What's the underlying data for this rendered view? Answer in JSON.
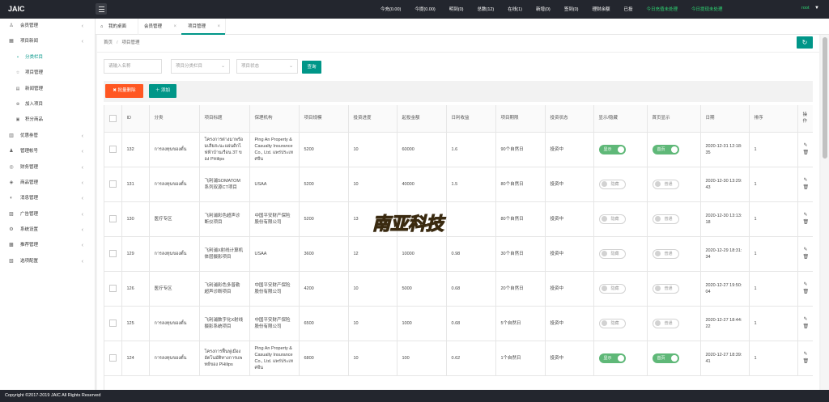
{
  "app": {
    "logo": "JAIC",
    "footer": "Copyright ©2017-2019 JAIC All Rights Reserved"
  },
  "header": {
    "stats": [
      {
        "label": "今充(0.00)",
        "color": "#ffffff"
      },
      {
        "label": "今提(0.00)",
        "color": "#ffffff"
      },
      {
        "label": "明到(0)",
        "color": "#ffffff"
      },
      {
        "label": "总数(12)",
        "color": "#ffffff"
      },
      {
        "label": "在线(1)",
        "color": "#ffffff"
      },
      {
        "label": "新增(0)",
        "color": "#ffffff"
      },
      {
        "label": "签到(0)",
        "color": "#ffffff"
      },
      {
        "label": "理财余额",
        "color": "#ffffff"
      },
      {
        "label": "已投",
        "color": "#ffffff"
      },
      {
        "label": "今日充值未处理",
        "color": "#2ed573"
      },
      {
        "label": "今日提现未处理",
        "color": "#2ed573"
      }
    ],
    "user": "root"
  },
  "sidebar": {
    "items": [
      {
        "label": "会员管理",
        "icon": "user-icon",
        "glyph": "♙",
        "sub": false,
        "chevron": true
      },
      {
        "label": "项目新闻",
        "icon": "grid-icon",
        "glyph": "▦",
        "sub": false,
        "chevron": true
      },
      {
        "label": "分类栏目",
        "icon": "bullet-icon",
        "glyph": "•",
        "sub": true,
        "chevron": false,
        "active": true
      },
      {
        "label": "项目管理",
        "icon": "star-icon",
        "glyph": "☆",
        "sub": true,
        "chevron": false
      },
      {
        "label": "新闻管理",
        "icon": "document-icon",
        "glyph": "▤",
        "sub": true,
        "chevron": false
      },
      {
        "label": "加入项目",
        "icon": "plus-icon",
        "glyph": "⊕",
        "sub": true,
        "chevron": false
      },
      {
        "label": "积分商品",
        "icon": "gift-icon",
        "glyph": "▣",
        "sub": true,
        "chevron": false
      },
      {
        "label": "优惠劵管",
        "icon": "ticket-icon",
        "glyph": "▥",
        "sub": false,
        "chevron": true
      },
      {
        "label": "管理帐号",
        "icon": "admin-icon",
        "glyph": "♟",
        "sub": false,
        "chevron": true
      },
      {
        "label": "财务管理",
        "icon": "money-icon",
        "glyph": "◎",
        "sub": false,
        "chevron": true
      },
      {
        "label": "商品管理",
        "icon": "shield-icon",
        "glyph": "◈",
        "sub": false,
        "chevron": true
      },
      {
        "label": "消息管理",
        "icon": "message-icon",
        "glyph": "◐",
        "sub": false,
        "chevron": true
      },
      {
        "label": "广告管理",
        "icon": "ad-icon",
        "glyph": "▨",
        "sub": false,
        "chevron": true
      },
      {
        "label": "系统设置",
        "icon": "settings-icon",
        "glyph": "⚙",
        "sub": false,
        "chevron": true
      },
      {
        "label": "推荐管理",
        "icon": "recommend-icon",
        "glyph": "▩",
        "sub": false,
        "chevron": true
      },
      {
        "label": "选项配置",
        "icon": "config-icon",
        "glyph": "▧",
        "sub": false,
        "chevron": true
      }
    ]
  },
  "tabs": {
    "home": "我的桌面",
    "tab1": "会员管理",
    "tab2": "项目管理",
    "close": "×",
    "home_icon": "⌂"
  },
  "breadcrumb": {
    "home": "首页",
    "sep": "/",
    "current": "项目管理"
  },
  "filters": {
    "name_placeholder": "请输入名称",
    "category_placeholder": "项目分类栏目",
    "status_placeholder": "项目状态",
    "search_label": "查询"
  },
  "actions": {
    "batch_delete": "✖ 批量删除",
    "add": "＋ 添加"
  },
  "table": {
    "headers": [
      "",
      "ID",
      "分类",
      "项目标题",
      "保理机构",
      "项目规模",
      "投资进度",
      "起投金额",
      "日利收益",
      "项目期限",
      "投资状态",
      "显示/隐藏",
      "首页显示",
      "日期",
      "排序",
      "操作"
    ],
    "rows": [
      {
        "id": "132",
        "category": "การลงทุนของตั้น",
        "title": "โครงการต่างมาพร้อมเสียสะนะแผ่นดิกไฟฟ้าบ้านเรือน 3T ของ PHilips",
        "org": "Ping An Property & Casualty Insurance Co., Ltd. แพร่ประเทศจีน",
        "scale": "5200",
        "progress": "10",
        "min": "60000",
        "rate": "1.6",
        "term": "90个自然日",
        "status": "投资中",
        "show": "显示",
        "show_on": true,
        "home": "首页",
        "home_on": true,
        "date": "2020-12-31 12:18:35",
        "sort": "1"
      },
      {
        "id": "131",
        "category": "การลงทุนของตั้น",
        "title": "飞利浦SOMATOM系列双源CT项目",
        "org": "USAA",
        "scale": "5200",
        "progress": "10",
        "min": "40000",
        "rate": "1.5",
        "term": "80个自然日",
        "status": "投资中",
        "show": "隐藏",
        "show_on": false,
        "home": "普通",
        "home_on": false,
        "date": "2020-12-30 13:29:43",
        "sort": "1"
      },
      {
        "id": "130",
        "category": "医疗专区",
        "title": "飞利浦彩色超声诊断仪项目",
        "org": "中国平安财产保险股份有限公司",
        "scale": "5200",
        "progress": "13",
        "min": "",
        "rate": "",
        "term": "80个自然日",
        "status": "投资中",
        "show": "隐藏",
        "show_on": false,
        "home": "普通",
        "home_on": false,
        "date": "2020-12-30 13:13:18",
        "sort": "1"
      },
      {
        "id": "129",
        "category": "การลงทุนของตั้น",
        "title": "飞利浦X射线计算机体层摄影项目",
        "org": "USAA",
        "scale": "3600",
        "progress": "12",
        "min": "10000",
        "rate": "0.98",
        "term": "30个自然日",
        "status": "投资中",
        "show": "隐藏",
        "show_on": false,
        "home": "普通",
        "home_on": false,
        "date": "2020-12-29 18:31:34",
        "sort": "1"
      },
      {
        "id": "126",
        "category": "医疗专区",
        "title": "飞利浦彩色多普勒超声诊断项目",
        "org": "中国平安财产保险股份有限公司",
        "scale": "4200",
        "progress": "10",
        "min": "5000",
        "rate": "0.68",
        "term": "20个自然日",
        "status": "投资中",
        "show": "隐藏",
        "show_on": false,
        "home": "普通",
        "home_on": false,
        "date": "2020-12-27 19:50:04",
        "sort": "1"
      },
      {
        "id": "125",
        "category": "การลงทุนของตั้น",
        "title": "飞利浦数字化X射线摄影系统项目",
        "org": "中国平安财产保险股份有限公司",
        "scale": "6500",
        "progress": "10",
        "min": "1000",
        "rate": "0.68",
        "term": "5个自然日",
        "status": "投资中",
        "show": "隐藏",
        "show_on": false,
        "home": "普通",
        "home_on": false,
        "date": "2020-12-27 18:44:22",
        "sort": "1"
      },
      {
        "id": "124",
        "category": "การลงทุนของตั้น",
        "title": "โครงการฟื้นฟูเมือง อัตโนมัติทางการแพทย์ของ PHilips",
        "org": "Ping An Property & Casualty Insurance Co., Ltd. แพร่ประเทศจีน",
        "scale": "6800",
        "progress": "10",
        "min": "100",
        "rate": "0.62",
        "term": "1个自然日",
        "status": "投资中",
        "show": "显示",
        "show_on": true,
        "home": "首页",
        "home_on": true,
        "date": "2020-12-27 18:39:41",
        "sort": "1"
      }
    ]
  },
  "ops": {
    "edit": "✎",
    "delete": "🗑"
  },
  "watermark": "南亚科技",
  "colors": {
    "accent": "#009688",
    "danger": "#ff5722",
    "switch_on": "#5fb878",
    "topbar": "#23262e"
  },
  "icons": {
    "refresh": "↻",
    "chevron": "‹",
    "caret": "▼",
    "dropdown": "⌄"
  }
}
